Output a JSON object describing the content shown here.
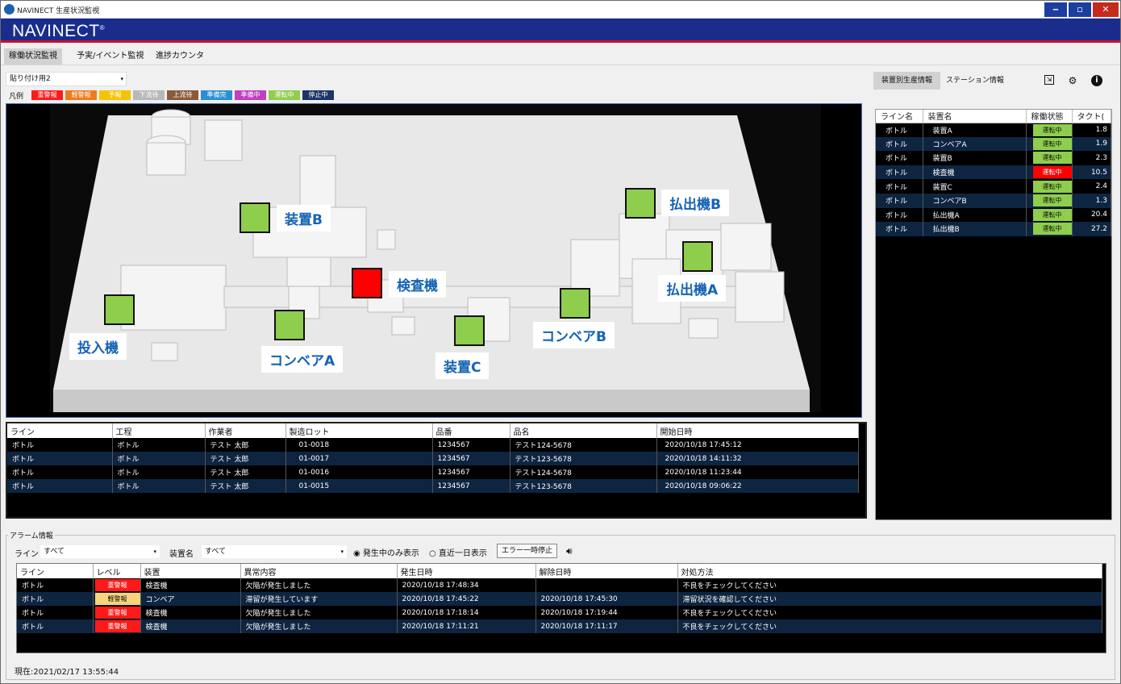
{
  "window": {
    "title": "NAVINECT 生産状況監視",
    "logo": "NAVINECT",
    "logo_mark": "®",
    "min": "‒",
    "max": "▫",
    "close": "✕"
  },
  "tabs": [
    {
      "label": "稼働状況監視"
    },
    {
      "label": "予実/イベント監視"
    },
    {
      "label": "進捗カウンタ"
    }
  ],
  "preset": {
    "value": "貼り付け用2",
    "arrow": "▾"
  },
  "legend": {
    "label": "凡例",
    "items": [
      {
        "text": "重警報",
        "color": "#ff1a1a"
      },
      {
        "text": "軽警報",
        "color": "#f07b1e"
      },
      {
        "text": "予報",
        "color": "#f5c400"
      },
      {
        "text": "下流待",
        "color": "#b8b8b8"
      },
      {
        "text": "上流待",
        "color": "#8b5a3c"
      },
      {
        "text": "準備完",
        "color": "#2a8fd6"
      },
      {
        "text": "準備中",
        "color": "#c03fc0"
      },
      {
        "text": "運転中",
        "color": "#8fce4d"
      },
      {
        "text": "停止中",
        "color": "#1b3566"
      }
    ]
  },
  "scene": {
    "markers": [
      {
        "name": "touny",
        "label": "投入機",
        "color": "#8fce4d"
      },
      {
        "name": "conveyor-a",
        "label": "コンベアA",
        "color": "#8fce4d"
      },
      {
        "name": "device-b",
        "label": "装置B",
        "color": "#8fce4d"
      },
      {
        "name": "inspector",
        "label": "検査機",
        "color": "#ff0000"
      },
      {
        "name": "device-c",
        "label": "装置C",
        "color": "#8fce4d"
      },
      {
        "name": "conveyor-b",
        "label": "コンベアB",
        "color": "#8fce4d"
      },
      {
        "name": "dispenser-b",
        "label": "払出機B",
        "color": "#8fce4d"
      },
      {
        "name": "dispenser-a",
        "label": "払出機A",
        "color": "#8fce4d"
      }
    ]
  },
  "right_tabs": {
    "production": "装置別生産情報",
    "station": "ステーション情報"
  },
  "equipment": {
    "headers": [
      "ライン名",
      "装置名",
      "稼働状態",
      "タクト("
    ],
    "rows": [
      {
        "line": "ボトル",
        "device": "装置A",
        "state": "運転中",
        "state_color": "#8fce4d",
        "takt": "1.8"
      },
      {
        "line": "ボトル",
        "device": "コンベアA",
        "state": "運転中",
        "state_color": "#8fce4d",
        "takt": "1.9"
      },
      {
        "line": "ボトル",
        "device": "装置B",
        "state": "運転中",
        "state_color": "#8fce4d",
        "takt": "2.3"
      },
      {
        "line": "ボトル",
        "device": "検査機",
        "state": "運転中",
        "state_color": "#ff0000",
        "takt": "10.5"
      },
      {
        "line": "ボトル",
        "device": "装置C",
        "state": "運転中",
        "state_color": "#8fce4d",
        "takt": "2.4"
      },
      {
        "line": "ボトル",
        "device": "コンベアB",
        "state": "運転中",
        "state_color": "#8fce4d",
        "takt": "1.3"
      },
      {
        "line": "ボトル",
        "device": "払出機A",
        "state": "運転中",
        "state_color": "#8fce4d",
        "takt": "20.4"
      },
      {
        "line": "ボトル",
        "device": "払出機B",
        "state": "運転中",
        "state_color": "#8fce4d",
        "takt": "27.2"
      }
    ]
  },
  "lots": {
    "headers": [
      "ライン",
      "工程",
      "作業者",
      "製造ロット",
      "品番",
      "品名",
      "開始日時"
    ],
    "rows": [
      [
        "ボトル",
        "ボトル",
        "テスト 太郎",
        "01-0018",
        "1234567",
        "テスト124-5678",
        "2020/10/18 17:45:12"
      ],
      [
        "ボトル",
        "ボトル",
        "テスト 太郎",
        "01-0017",
        "1234567",
        "テスト123-5678",
        "2020/10/18 14:11:32"
      ],
      [
        "ボトル",
        "ボトル",
        "テスト 太郎",
        "01-0016",
        "1234567",
        "テスト124-5678",
        "2020/10/18 11:23:44"
      ],
      [
        "ボトル",
        "ボトル",
        "テスト 太郎",
        "01-0015",
        "1234567",
        "テスト123-5678",
        "2020/10/18 09:06:22"
      ]
    ]
  },
  "alarm": {
    "group_title": "アラーム情報",
    "line_label": "ライン",
    "line_value": "すべて",
    "device_label": "装置名",
    "device_value": "すべて",
    "radio_active": "発生中のみ表示",
    "radio_other": "直近一日表示",
    "pause_button": "エラー一時停止",
    "headers": [
      "ライン",
      "レベル",
      "装置",
      "異常内容",
      "発生日時",
      "解除日時",
      "対処方法"
    ],
    "rows": [
      {
        "line": "ボトル",
        "level": "重警報",
        "level_color": "#ff1a1a",
        "device": "検査機",
        "desc": "欠陥が発生しました",
        "occ": "2020/10/18 17:48:34",
        "clr": "",
        "action": "不良をチェックしてください"
      },
      {
        "line": "ボトル",
        "level": "軽警報",
        "level_color": "#f7d37a",
        "device": "コンベア",
        "desc": "滞留が発生しています",
        "occ": "2020/10/18 17:45:22",
        "clr": "2020/10/18 17:45:30",
        "action": "滞留状況を確認してください"
      },
      {
        "line": "ボトル",
        "level": "重警報",
        "level_color": "#ff1a1a",
        "device": "検査機",
        "desc": "欠陥が発生しました",
        "occ": "2020/10/18 17:18:14",
        "clr": "2020/10/18 17:19:44",
        "action": "不良をチェックしてください"
      },
      {
        "line": "ボトル",
        "level": "重警報",
        "level_color": "#ff1a1a",
        "device": "検査機",
        "desc": "欠陥が発生しました",
        "occ": "2020/10/18 17:11:21",
        "clr": "2020/10/18 17:11:17",
        "action": "不良をチェックしてください"
      }
    ]
  },
  "status": {
    "clock": "現在:2021/02/17 13:55:44"
  }
}
